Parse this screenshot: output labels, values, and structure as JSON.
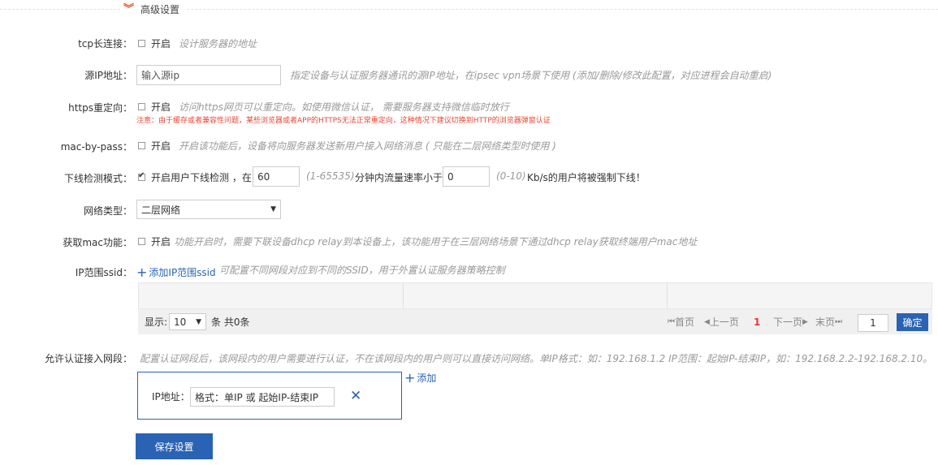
{
  "section": {
    "title": "高级设置",
    "icon": "double-chevron-down-icon"
  },
  "tcp": {
    "label": "tcp长连接：",
    "checkbox_label": "开启",
    "checked": false,
    "hint": "设计服务器的地址"
  },
  "source_ip": {
    "label": "源IP地址：",
    "placeholder": "输入源ip",
    "hint": "指定设备与认证服务器通讯的源IP地址，在ipsec vpn场景下使用 (添加/删除/修改此配置，对应进程会自动重启)"
  },
  "https": {
    "label": "https重定向：",
    "checkbox_label": "开启",
    "checked": false,
    "hint": "访问https网页可以重定向。如使用微信认证， 需要服务器支持微信临时放行",
    "warning": "注意：由于缓存或者兼容性问题，某些浏览器或者APP的HTTPS无法正常重定向，这种情况下建议切换到HTTP的浏览器弹窗认证"
  },
  "mac_bypass": {
    "label": "mac-by-pass：",
    "checkbox_label": "开启",
    "checked": false,
    "hint": "开启该功能后，设备将向服务器发送新用户接入网络消息 ( 只能在二层网络类型时使用 )"
  },
  "offline": {
    "label": "下线检测模式：",
    "checked": true,
    "text1": "开启用户下线检测 ，在",
    "minutes": "60",
    "range1": "(1-65535)",
    "text2": "分钟内流量速率小于",
    "rate": "0",
    "range2": "(0-10)",
    "text3": "Kb/s的用户将被强制下线！"
  },
  "network_type": {
    "label": "网络类型：",
    "selected": "二层网络"
  },
  "get_mac": {
    "label": "获取mac功能：",
    "checkbox_label": "开启",
    "checked": false,
    "hint": "功能开启时，需要下联设备dhcp relay到本设备上，该功能用于在三层网络场景下通过dhcp relay获取终端用户mac地址"
  },
  "ip_ssid": {
    "label": "IP范围ssid：",
    "add_label": "添加IP范围ssid",
    "hint": "可配置不同网段对应到不同的SSID，用于外置认证服务器策略控制",
    "pager": {
      "show_label": "显示:",
      "page_size": "10",
      "count_text": "条 共0条",
      "first": "首页",
      "prev": "上一页",
      "current": "1",
      "next": "下一页",
      "last": "末页",
      "page_input": "1",
      "confirm": "确定"
    }
  },
  "allowed": {
    "label": "允许认证接入网段：",
    "hint": "配置认证网段后，该网段内的用户需要进行认证，不在该网段内的用户则可以直接访问网络。单IP格式：如：192.168.1.2 IP范围：起始IP-结束IP，如：192.168.2.2-192.168.2.10。",
    "ip_label": "IP地址：",
    "ip_placeholder": "格式：单IP 或 起始IP-结束IP",
    "add_label": "添加"
  },
  "save_label": "保存设置",
  "colors": {
    "accent": "#2a63b3",
    "warning": "#e43",
    "chevron": "#e8582b"
  }
}
